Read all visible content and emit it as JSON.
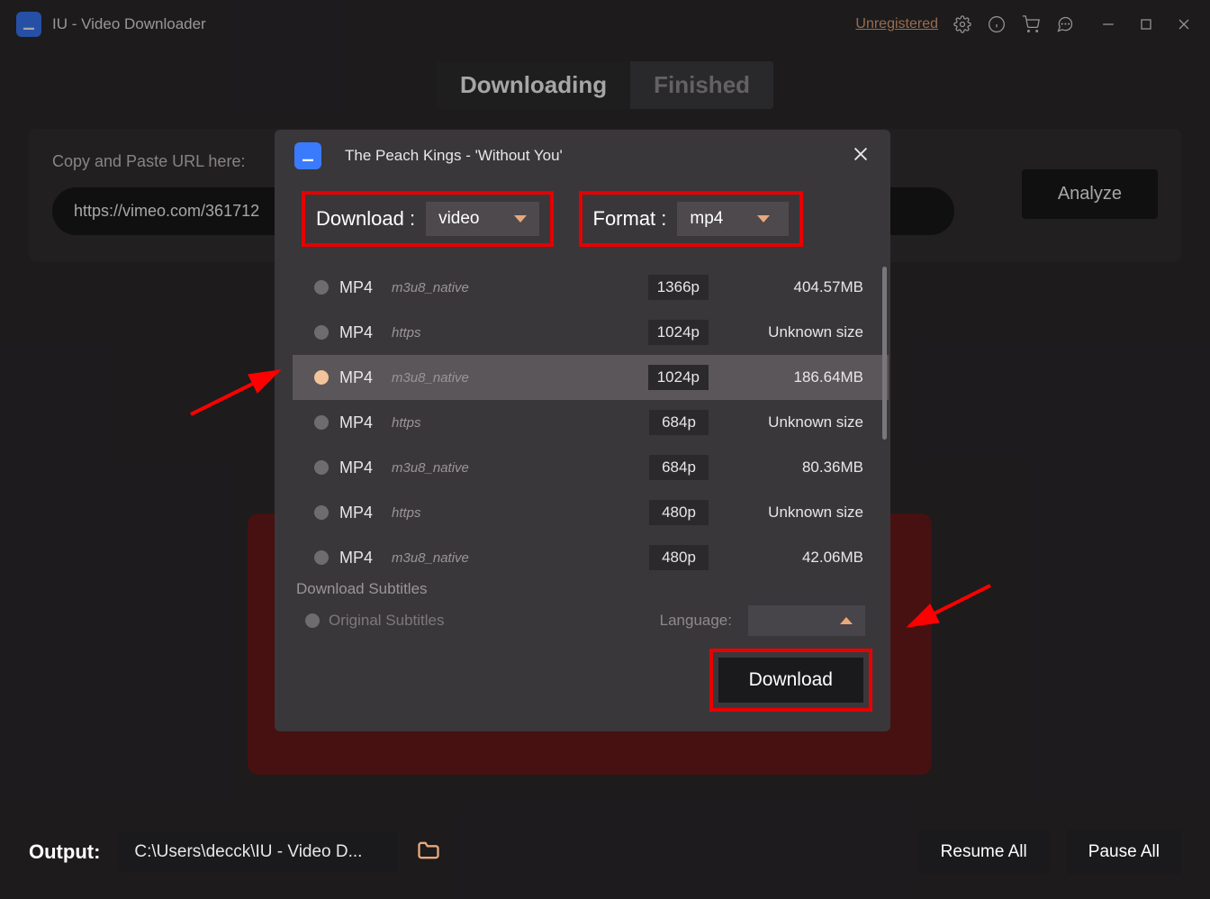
{
  "app": {
    "title": "IU - Video Downloader"
  },
  "titlebar": {
    "unregistered": "Unregistered"
  },
  "tabs": {
    "downloading": "Downloading",
    "finished": "Finished"
  },
  "urlsection": {
    "label": "Copy and Paste URL here:",
    "value": "https://vimeo.com/361712",
    "analyze": "Analyze"
  },
  "modal": {
    "title": "The Peach Kings - 'Without You'",
    "download_label": "Download :",
    "download_value": "video",
    "format_label": "Format :",
    "format_value": "mp4",
    "subtitles_head": "Download Subtitles",
    "subtitles_original": "Original Subtitles",
    "language_label": "Language:",
    "download_button": "Download",
    "formats": [
      {
        "name": "MP4",
        "proto": "m3u8_native",
        "res": "1366p",
        "size": "404.57MB",
        "selected": false
      },
      {
        "name": "MP4",
        "proto": "https",
        "res": "1024p",
        "size": "Unknown size",
        "selected": false
      },
      {
        "name": "MP4",
        "proto": "m3u8_native",
        "res": "1024p",
        "size": "186.64MB",
        "selected": true
      },
      {
        "name": "MP4",
        "proto": "https",
        "res": "684p",
        "size": "Unknown size",
        "selected": false
      },
      {
        "name": "MP4",
        "proto": "m3u8_native",
        "res": "684p",
        "size": "80.36MB",
        "selected": false
      },
      {
        "name": "MP4",
        "proto": "https",
        "res": "480p",
        "size": "Unknown size",
        "selected": false
      },
      {
        "name": "MP4",
        "proto": "m3u8_native",
        "res": "480p",
        "size": "42.06MB",
        "selected": false
      }
    ]
  },
  "output": {
    "label": "Output:",
    "path": "C:\\Users\\decck\\IU - Video D...",
    "resume": "Resume All",
    "pause": "Pause All"
  }
}
